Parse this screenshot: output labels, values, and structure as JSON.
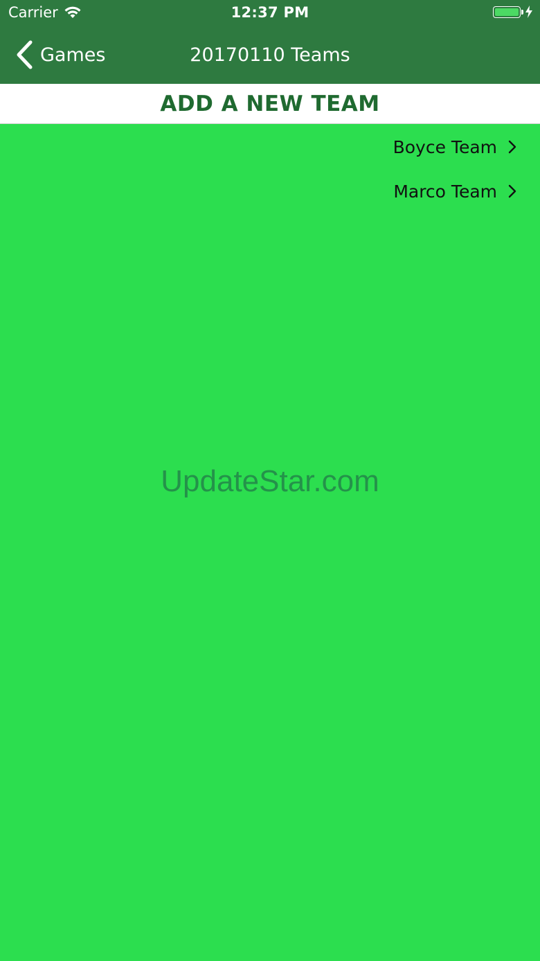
{
  "status_bar": {
    "carrier": "Carrier",
    "time": "12:37 PM",
    "wifi_icon": "wifi-icon",
    "battery_icon": "battery-icon",
    "charging_icon": "bolt-icon"
  },
  "nav": {
    "back_label": "Games",
    "back_icon": "chevron-left-icon",
    "title": "20170110 Teams"
  },
  "add_team": {
    "label": "ADD A NEW TEAM"
  },
  "teams": [
    {
      "label": "Boyce Team",
      "icon": "chevron-right-icon"
    },
    {
      "label": "Marco Team",
      "icon": "chevron-right-icon"
    }
  ],
  "watermark": "UpdateStar.com",
  "colors": {
    "nav_background": "#2e7a40",
    "page_background": "#2cde4f",
    "add_team_text": "#1f6a30",
    "battery_fill": "#4cd964"
  }
}
